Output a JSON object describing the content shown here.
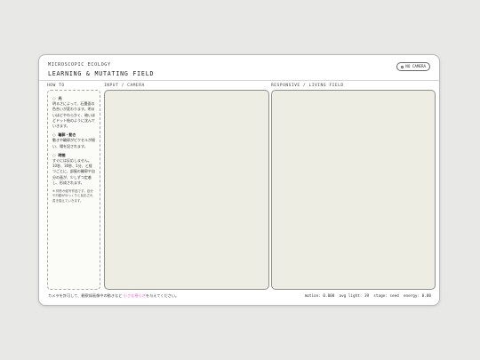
{
  "header": {
    "eyebrow": "MICROSCOPIC ECOLOGY",
    "title": "LEARNING & MUTATING FIELD",
    "camera_button": "NO CAMERA"
  },
  "columns": {
    "howto": "HOW TO",
    "input": "INPUT / CAMERA",
    "living": "RESPONSIVE / LIVING FIELD"
  },
  "howto": {
    "items": [
      {
        "mark": "○",
        "heading": "光",
        "body": "明るさによって、石畳面の色合いが変わります。明るいほどやわらかく、暗いほどドット絵のように沈んでいきます。"
      },
      {
        "mark": "○",
        "heading": "輪郭・動き",
        "body": "動きや輪郭がピクセルが揺い、場を記されます。"
      },
      {
        "mark": "○",
        "heading": "時間",
        "body": "すぐには反応しません。10秒、30秒、1分、と経つごとに、部屋の輪郭や自分の画が、少しずつ定着し、形成されます。"
      }
    ],
    "note": "※ 何秒か経写作品です。自分や行動がゆっくりと反応され書き換えていきます。"
  },
  "footer": {
    "hint_before": "カメラを許可して、観察録画像中の動きなど ",
    "hint_accent": "小さな揺らぎ",
    "hint_after": "を与えてください。",
    "stats": "motion: 0.000  avg light: 39  stage: seed  energy: 0.00"
  },
  "colors": {
    "accent": "#e75cd3",
    "field_bg": "#ededE3",
    "background": "#e8e8e6"
  }
}
